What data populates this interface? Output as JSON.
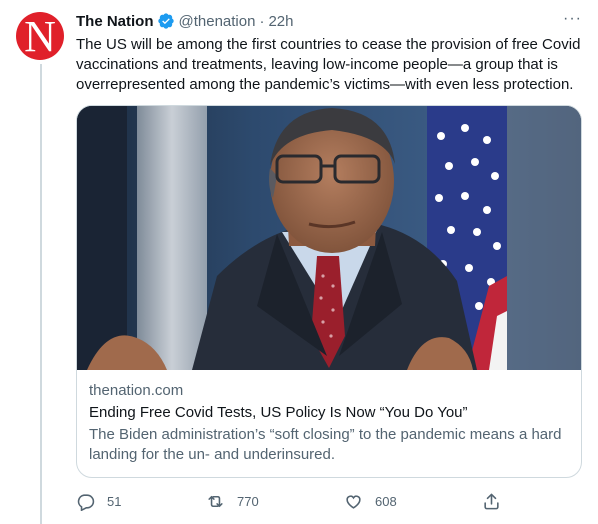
{
  "tweet": {
    "avatar_letter": "N",
    "display_name": "The Nation",
    "handle": "@thenation",
    "separator": "·",
    "time": "22h",
    "more_label": "···",
    "text": "The US will be among the first countries to cease the provision of free Covid vaccinations and treatments, leaving low-income people—a group that is overrepresented among the pandemic’s victims—with even less protection."
  },
  "card": {
    "domain": "thenation.com",
    "title": "Ending Free Covid Tests, US Policy Is Now “You Do You”",
    "description": "The Biden administration’s “soft closing” to the pandemic means a hard landing for the un- and underinsured."
  },
  "actions": {
    "reply_count": "51",
    "retweet_count": "770",
    "like_count": "608"
  },
  "colors": {
    "avatar_red": "#e0202a",
    "verified_blue": "#1d9bf0",
    "secondary_text": "#536471",
    "border": "#cfd9de"
  },
  "icons": [
    "verified-badge-icon",
    "more-icon",
    "reply-icon",
    "retweet-icon",
    "like-icon",
    "share-icon"
  ]
}
